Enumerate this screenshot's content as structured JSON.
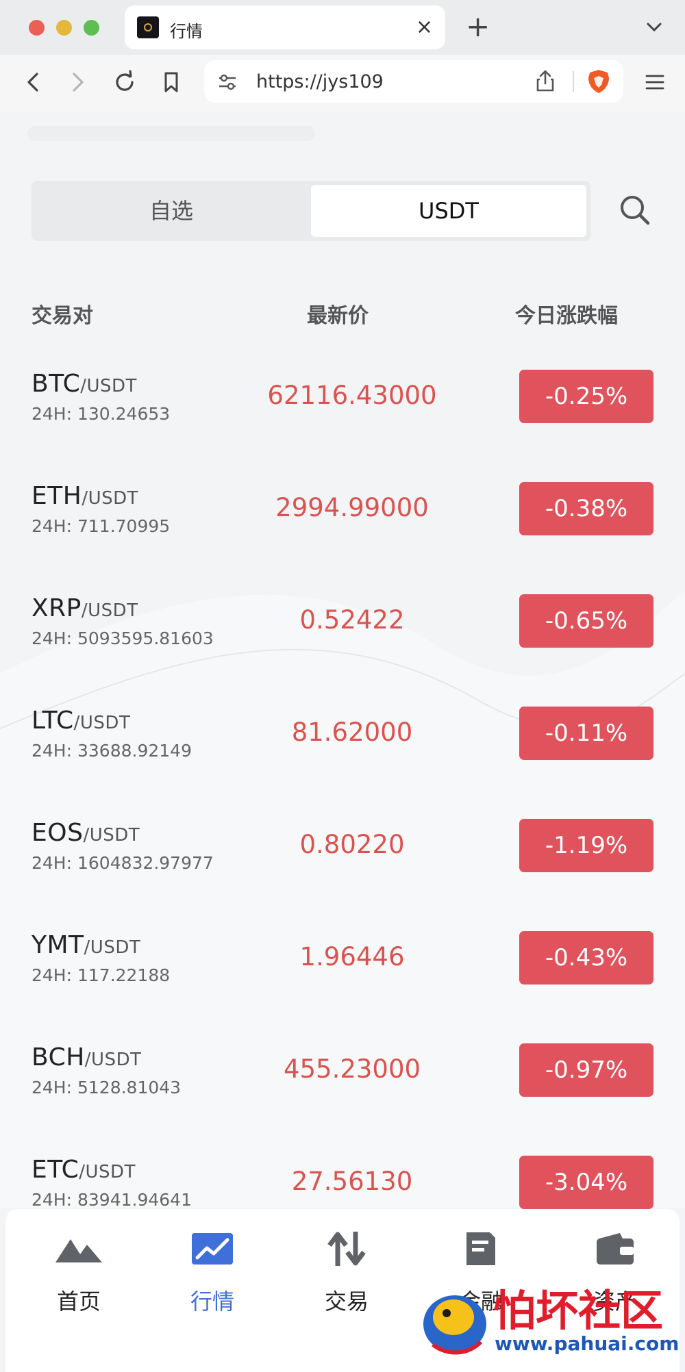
{
  "browser": {
    "tab_title": "行情",
    "tab_close": "×",
    "new_tab": "+",
    "url": "https://jys109",
    "icons": [
      "back-icon",
      "forward-icon",
      "reload-icon",
      "bookmark-icon",
      "site-settings-icon",
      "share-icon",
      "brave-shield-icon",
      "menu-icon"
    ]
  },
  "segment": {
    "left_label": "自选",
    "right_label": "USDT",
    "active": "USDT"
  },
  "columns": {
    "pair": "交易对",
    "price": "最新价",
    "change": "今日涨跌幅"
  },
  "markets": [
    {
      "base": "BTC",
      "quote": "/USDT",
      "volume": "24H: 130.24653",
      "price": "62116.43000",
      "change": "-0.25%"
    },
    {
      "base": "ETH",
      "quote": "/USDT",
      "volume": "24H: 711.70995",
      "price": "2994.99000",
      "change": "-0.38%"
    },
    {
      "base": "XRP",
      "quote": "/USDT",
      "volume": "24H: 5093595.81603",
      "price": "0.52422",
      "change": "-0.65%"
    },
    {
      "base": "LTC",
      "quote": "/USDT",
      "volume": "24H: 33688.92149",
      "price": "81.62000",
      "change": "-0.11%"
    },
    {
      "base": "EOS",
      "quote": "/USDT",
      "volume": "24H: 1604832.97977",
      "price": "0.80220",
      "change": "-1.19%"
    },
    {
      "base": "YMT",
      "quote": "/USDT",
      "volume": "24H: 117.22188",
      "price": "1.96446",
      "change": "-0.43%"
    },
    {
      "base": "BCH",
      "quote": "/USDT",
      "volume": "24H: 5128.81043",
      "price": "455.23000",
      "change": "-0.97%"
    },
    {
      "base": "ETC",
      "quote": "/USDT",
      "volume": "24H: 83941.94641",
      "price": "27.56130",
      "change": "-3.04%"
    }
  ],
  "bottom_nav": [
    {
      "label": "首页",
      "icon": "home-mountain-icon",
      "active": false
    },
    {
      "label": "行情",
      "icon": "market-chart-icon",
      "active": true
    },
    {
      "label": "交易",
      "icon": "trade-arrows-icon",
      "active": false
    },
    {
      "label": "金融",
      "icon": "finance-document-icon",
      "active": false
    },
    {
      "label": "资产",
      "icon": "wallet-icon",
      "active": false
    }
  ],
  "colors": {
    "down_red": "#e0525c",
    "price_red": "#d9534f",
    "active_blue": "#3f6fd9"
  },
  "watermark": {
    "title": "怕坏社区",
    "url": "www.pahuai.com"
  }
}
